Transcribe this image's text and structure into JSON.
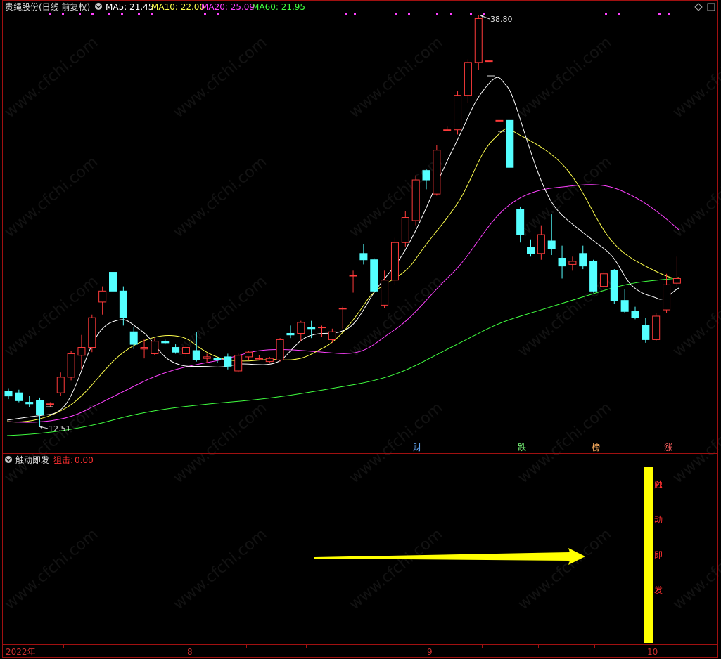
{
  "header": {
    "stock": "贵绳股份",
    "mode": "(日线 前复权)",
    "ma5": "MA5: 21.45",
    "ma10": "MA10: 22.00",
    "ma20": "MA20: 25.09",
    "ma60": "MA60: 21.95"
  },
  "indicator": {
    "name": "触动即发",
    "label": "狙击:",
    "value": "0.00",
    "bar_chars": [
      "触",
      "动",
      "即",
      "发"
    ]
  },
  "markers": {
    "high": "38.80",
    "low": "12.51"
  },
  "events": [
    {
      "label": "财",
      "color": "#6ab0ff"
    },
    {
      "label": "跌",
      "color": "#7cff7c"
    },
    {
      "label": "榜",
      "color": "#ffb060"
    },
    {
      "label": "涨",
      "color": "#ff6060"
    }
  ],
  "xaxis": {
    "labels": [
      "2022年",
      "8",
      "9",
      "10"
    ]
  },
  "colors": {
    "up": "#ff3b3b",
    "down": "#54ffff",
    "ma5": "#ffffff",
    "ma10": "#ffff4c",
    "ma20": "#ff40ff",
    "ma60": "#40ff40",
    "frame": "#a01010",
    "indicator_bar": "#ffff00"
  },
  "watermark": "www.cfchi.com",
  "chart_data": {
    "type": "candlestick",
    "title": "贵绳股份 (日线 前复权)",
    "ylim": [
      12.51,
      38.8
    ],
    "candles": [
      {
        "o": 14.8,
        "h": 15.0,
        "l": 14.3,
        "c": 14.5
      },
      {
        "o": 14.7,
        "h": 14.9,
        "l": 14.1,
        "c": 14.2
      },
      {
        "o": 14.1,
        "h": 14.5,
        "l": 13.8,
        "c": 14.0
      },
      {
        "o": 14.2,
        "h": 14.4,
        "l": 12.51,
        "c": 13.3
      },
      {
        "o": 14.0,
        "h": 14.1,
        "l": 13.8,
        "c": 14.0
      },
      {
        "o": 14.7,
        "h": 16.0,
        "l": 14.5,
        "c": 15.7
      },
      {
        "o": 15.7,
        "h": 17.4,
        "l": 15.5,
        "c": 17.2
      },
      {
        "o": 17.1,
        "h": 18.4,
        "l": 16.2,
        "c": 17.6
      },
      {
        "o": 17.6,
        "h": 19.7,
        "l": 17.3,
        "c": 19.5
      },
      {
        "o": 20.5,
        "h": 21.5,
        "l": 19.7,
        "c": 21.2
      },
      {
        "o": 22.4,
        "h": 23.7,
        "l": 20.6,
        "c": 21.2
      },
      {
        "o": 21.2,
        "h": 21.5,
        "l": 19.0,
        "c": 19.5
      },
      {
        "o": 18.6,
        "h": 18.9,
        "l": 17.5,
        "c": 17.8
      },
      {
        "o": 17.5,
        "h": 18.1,
        "l": 16.9,
        "c": 17.6
      },
      {
        "o": 17.2,
        "h": 18.2,
        "l": 17.1,
        "c": 18.0
      },
      {
        "o": 18.0,
        "h": 18.1,
        "l": 17.8,
        "c": 17.9
      },
      {
        "o": 17.6,
        "h": 17.8,
        "l": 17.2,
        "c": 17.3
      },
      {
        "o": 17.2,
        "h": 17.8,
        "l": 17.0,
        "c": 17.6
      },
      {
        "o": 17.4,
        "h": 18.6,
        "l": 16.7,
        "c": 16.8
      },
      {
        "o": 16.9,
        "h": 17.2,
        "l": 16.6,
        "c": 17.0
      },
      {
        "o": 16.9,
        "h": 17.0,
        "l": 16.6,
        "c": 16.8
      },
      {
        "o": 17.0,
        "h": 17.2,
        "l": 16.2,
        "c": 16.4
      },
      {
        "o": 16.1,
        "h": 17.2,
        "l": 16.0,
        "c": 17.1
      },
      {
        "o": 17.0,
        "h": 17.4,
        "l": 16.8,
        "c": 17.3
      },
      {
        "o": 16.9,
        "h": 17.1,
        "l": 16.8,
        "c": 16.9
      },
      {
        "o": 16.7,
        "h": 17.0,
        "l": 16.6,
        "c": 16.9
      },
      {
        "o": 16.8,
        "h": 18.2,
        "l": 16.7,
        "c": 18.1
      },
      {
        "o": 18.5,
        "h": 19.0,
        "l": 18.2,
        "c": 18.4
      },
      {
        "o": 18.5,
        "h": 19.3,
        "l": 18.0,
        "c": 19.2
      },
      {
        "o": 18.9,
        "h": 19.3,
        "l": 18.2,
        "c": 18.8
      },
      {
        "o": 18.9,
        "h": 19.0,
        "l": 18.3,
        "c": 18.9
      },
      {
        "o": 18.1,
        "h": 18.8,
        "l": 17.9,
        "c": 18.6
      },
      {
        "o": 20.1,
        "h": 20.2,
        "l": 18.8,
        "c": 20.1
      },
      {
        "o": 22.2,
        "h": 22.5,
        "l": 21.1,
        "c": 22.2
      },
      {
        "o": 23.6,
        "h": 24.2,
        "l": 22.9,
        "c": 23.2
      },
      {
        "o": 23.2,
        "h": 23.3,
        "l": 21.1,
        "c": 21.2
      },
      {
        "o": 20.3,
        "h": 22.5,
        "l": 20.1,
        "c": 21.9
      },
      {
        "o": 21.9,
        "h": 24.6,
        "l": 21.6,
        "c": 24.3
      },
      {
        "o": 24.3,
        "h": 26.3,
        "l": 24.0,
        "c": 25.9
      },
      {
        "o": 25.7,
        "h": 28.6,
        "l": 25.4,
        "c": 28.3
      },
      {
        "o": 28.9,
        "h": 29.0,
        "l": 27.7,
        "c": 28.3
      },
      {
        "o": 27.4,
        "h": 30.5,
        "l": 27.3,
        "c": 30.2
      },
      {
        "o": 31.5,
        "h": 31.7,
        "l": 31.5,
        "c": 31.5
      },
      {
        "o": 31.5,
        "h": 34.0,
        "l": 31.2,
        "c": 33.7
      },
      {
        "o": 33.7,
        "h": 36.0,
        "l": 33.2,
        "c": 35.8
      },
      {
        "o": 35.8,
        "h": 38.8,
        "l": 35.3,
        "c": 38.6
      },
      {
        "o": 35.9,
        "h": 35.9,
        "l": 35.9,
        "c": 35.9
      },
      {
        "o": 32.1,
        "h": 32.1,
        "l": 32.1,
        "c": 32.1
      },
      {
        "o": 32.1,
        "h": 32.1,
        "l": 29.1,
        "c": 29.1
      },
      {
        "o": 26.4,
        "h": 26.6,
        "l": 24.3,
        "c": 24.8
      },
      {
        "o": 24.0,
        "h": 24.5,
        "l": 23.4,
        "c": 23.6
      },
      {
        "o": 23.6,
        "h": 25.4,
        "l": 23.2,
        "c": 24.8
      },
      {
        "o": 24.4,
        "h": 26.1,
        "l": 23.5,
        "c": 23.9
      },
      {
        "o": 23.3,
        "h": 24.1,
        "l": 22.0,
        "c": 22.8
      },
      {
        "o": 22.9,
        "h": 23.4,
        "l": 22.5,
        "c": 23.1
      },
      {
        "o": 23.6,
        "h": 24.1,
        "l": 22.6,
        "c": 22.8
      },
      {
        "o": 23.1,
        "h": 23.2,
        "l": 21.1,
        "c": 21.2
      },
      {
        "o": 21.5,
        "h": 22.5,
        "l": 21.3,
        "c": 22.3
      },
      {
        "o": 22.5,
        "h": 22.6,
        "l": 20.4,
        "c": 20.6
      },
      {
        "o": 20.6,
        "h": 21.3,
        "l": 19.8,
        "c": 19.9
      },
      {
        "o": 19.9,
        "h": 20.2,
        "l": 19.4,
        "c": 19.5
      },
      {
        "o": 19.0,
        "h": 19.5,
        "l": 17.9,
        "c": 18.1
      },
      {
        "o": 18.1,
        "h": 19.8,
        "l": 18.0,
        "c": 19.6
      },
      {
        "o": 20.0,
        "h": 22.3,
        "l": 19.8,
        "c": 21.6
      },
      {
        "o": 21.7,
        "h": 23.4,
        "l": 21.5,
        "c": 22.0
      }
    ]
  }
}
